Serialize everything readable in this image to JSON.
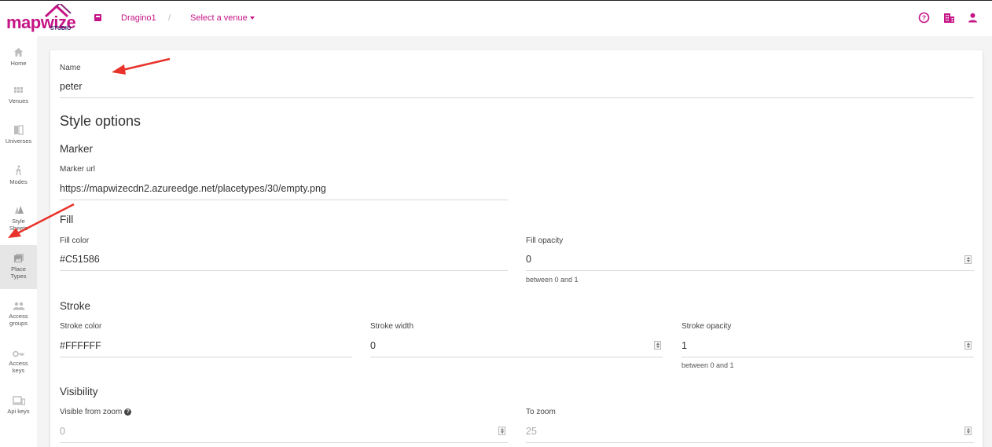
{
  "app": {
    "logo_text": "mapwize",
    "logo_sub": "STUDIO",
    "brand_color": "#C51586"
  },
  "topbar": {
    "organization": "Dragino1",
    "separator": "/",
    "venue_select": "Select a venue",
    "icons": [
      "venue-icon",
      "help-icon",
      "organization-icon",
      "user-icon"
    ]
  },
  "sidebar": {
    "items": [
      {
        "label": "Home",
        "icon": "home-icon"
      },
      {
        "label": "Venues",
        "icon": "grid-icon"
      },
      {
        "label": "Universes",
        "icon": "universe-icon"
      },
      {
        "label": "Modes",
        "icon": "walk-icon"
      },
      {
        "label": "Style\nSheets",
        "icon": "style-sheets-icon"
      },
      {
        "label": "Place\nTypes",
        "icon": "place-types-icon",
        "active": true
      },
      {
        "label": "Access\ngroups",
        "icon": "people-icon"
      },
      {
        "label": "Access\nkeys",
        "icon": "key-icon"
      },
      {
        "label": "Api keys",
        "icon": "devices-icon"
      }
    ]
  },
  "form": {
    "name": {
      "label": "Name",
      "value": "peter"
    },
    "style_options_title": "Style options",
    "marker": {
      "title": "Marker",
      "url_label": "Marker url",
      "url_value": "https://mapwizecdn2.azureedge.net/placetypes/30/empty.png"
    },
    "fill": {
      "title": "Fill",
      "color_label": "Fill color",
      "color_value": "#C51586",
      "opacity_label": "Fill opacity",
      "opacity_value": "0",
      "opacity_hint": "between 0 and 1"
    },
    "stroke": {
      "title": "Stroke",
      "color_label": "Stroke color",
      "color_value": "#FFFFFF",
      "width_label": "Stroke width",
      "width_value": "0",
      "opacity_label": "Stroke opacity",
      "opacity_value": "1",
      "opacity_hint": "between 0 and 1"
    },
    "visibility": {
      "title": "Visibility",
      "from_label": "Visible from zoom",
      "from_value": "0",
      "to_label": "To zoom",
      "to_value": "25"
    }
  },
  "annotation_color": "#E8322B"
}
